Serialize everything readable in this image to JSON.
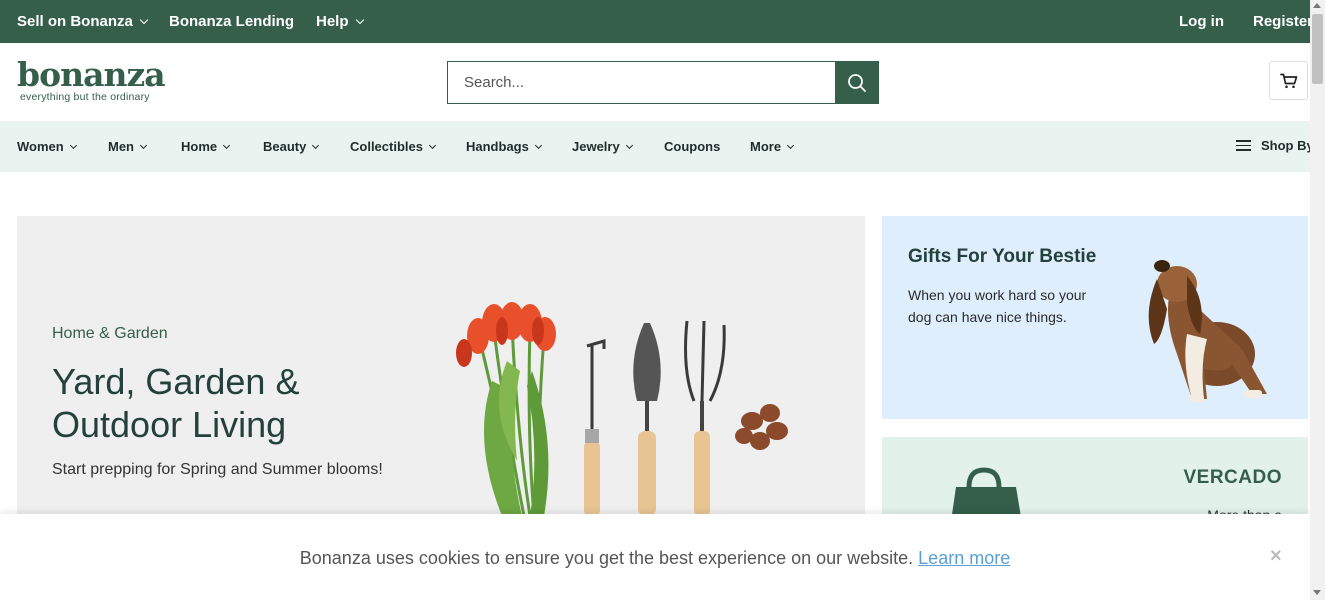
{
  "topbar": {
    "sell": "Sell on Bonanza",
    "lending": "Bonanza Lending",
    "help": "Help",
    "login": "Log in",
    "register": "Register"
  },
  "header": {
    "logo": "bonanza",
    "tagline": "everything but the ordinary",
    "search_placeholder": "Search...",
    "icons": {
      "search": "search-icon",
      "cart": "cart-icon"
    }
  },
  "nav": {
    "items": [
      {
        "label": "Women"
      },
      {
        "label": "Men"
      },
      {
        "label": "Home"
      },
      {
        "label": "Beauty"
      },
      {
        "label": "Collectibles"
      },
      {
        "label": "Handbags"
      },
      {
        "label": "Jewelry"
      },
      {
        "label": "Coupons"
      },
      {
        "label": "More"
      }
    ],
    "shop_by": "Shop By"
  },
  "hero": {
    "eyebrow": "Home & Garden",
    "title": "Yard, Garden & Outdoor Living",
    "subtitle": "Start prepping for Spring and Summer blooms!"
  },
  "card1": {
    "title": "Gifts For Your Bestie",
    "text": "When you work hard so your dog can have nice things."
  },
  "card2": {
    "title": "VERCADO",
    "text": "More than a"
  },
  "cookie": {
    "message": "Bonanza uses cookies to ensure you get the best experience on our website.",
    "link": "Learn more",
    "close": "×"
  },
  "colors": {
    "brand": "#355e4b",
    "nav_bg": "#e9f3f0",
    "card1_bg": "#dfeefc",
    "card2_bg": "#e2f2eb",
    "link": "#5aa0d6"
  }
}
